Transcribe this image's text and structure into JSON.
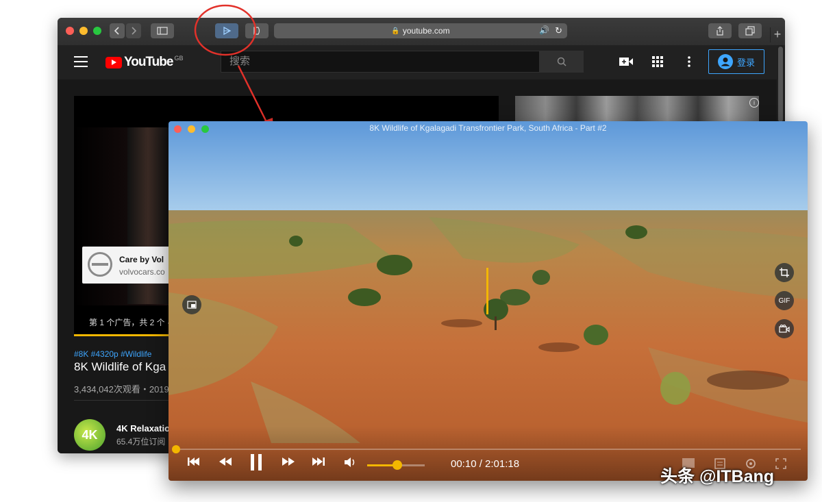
{
  "safari": {
    "url": "youtube.com",
    "search_placeholder": "搜索",
    "login_label": "登录",
    "logo_text": "YouTube",
    "region_badge": "GB"
  },
  "youtube_page": {
    "ad_title": "Care by Vol",
    "ad_url": "volvocars.co",
    "ad_count_text": "第 1 个广告，共 2 个 ·",
    "hashtags": "#8K #4320p #Wildlife",
    "video_title": "8K Wildlife of Kga",
    "views": "3,434,042次观看・2019",
    "channel_name": "4K Relaxatio",
    "subscribers": "65.4万位订阅",
    "channel_avatar_text": "4K"
  },
  "pip": {
    "title": "8K Wildlife of Kgalagadi Transfrontier Park, South Africa - Part #2",
    "current_time": "00:10",
    "duration": "2:01:18",
    "time_display": "00:10 / 2:01:18",
    "volume_fraction": 0.52,
    "progress_fraction": 0.0014,
    "gif_label": "GIF"
  },
  "watermark": "头条 @ITBang",
  "colors": {
    "accent": "#f3b700",
    "annotation_red": "#e2312a",
    "youtube_red": "#ff0000",
    "link_blue": "#3ea6ff"
  }
}
